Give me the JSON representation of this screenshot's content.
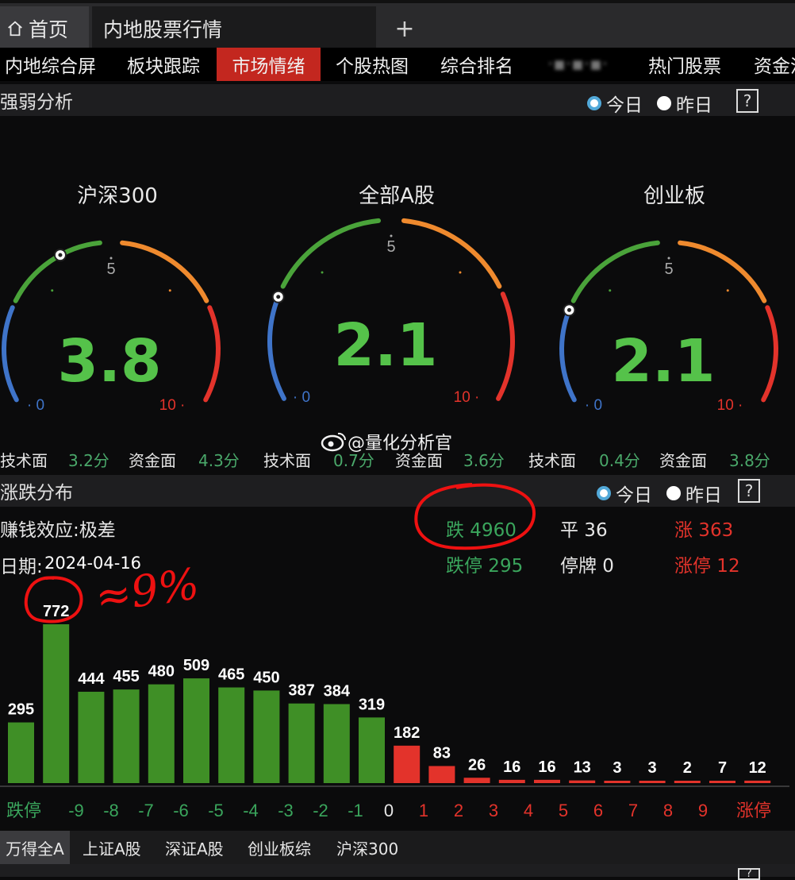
{
  "tabs": {
    "home": "首页",
    "active": "内地股票行情",
    "add": "+"
  },
  "nav": [
    "内地综合屏",
    "板块跟踪",
    "市场情绪",
    "个股热图",
    "综合排名",
    "·▪·▪·▪·",
    "热门股票",
    "资金流"
  ],
  "nav_active_index": 2,
  "strength": {
    "title": "强弱分析",
    "today": "今日",
    "yesterday": "昨日",
    "help": "?",
    "gauges": [
      {
        "title": "沪深300",
        "value": "3.8",
        "mid": "5",
        "min": "0",
        "max": "10",
        "level": 3.8,
        "tech_label": "技术面",
        "tech": "3.2分",
        "fund_label": "资金面",
        "fund": "4.3分"
      },
      {
        "title": "全部A股",
        "value": "2.1",
        "mid": "5",
        "min": "0",
        "max": "10",
        "level": 2.1,
        "tech_label": "技术面",
        "tech": "0.7分",
        "fund_label": "资金面",
        "fund": "3.6分"
      },
      {
        "title": "创业板",
        "value": "2.1",
        "mid": "5",
        "min": "0",
        "max": "10",
        "level": 2.1,
        "tech_label": "技术面",
        "tech": "0.4分",
        "fund_label": "资金面",
        "fund": "3.8分"
      }
    ]
  },
  "watermark": "@量化分析官",
  "distribution": {
    "title": "涨跌分布",
    "today": "今日",
    "yesterday": "昨日",
    "help": "?",
    "effect": "赚钱效应:极差",
    "date_label": "日期:",
    "date": "2024-04-16",
    "down": "跌 4960",
    "flat": "平 36",
    "up": "涨 363",
    "limit_down": "跌停 295",
    "suspended": "停牌 0",
    "limit_up": "涨停 12",
    "annotation": "≈9%"
  },
  "colors": {
    "green": "#3f8f26",
    "red": "#e3332b",
    "accent": "#c3271f"
  },
  "chart_data": {
    "type": "bar",
    "categories": [
      "跌停",
      "-9",
      "-8",
      "-7",
      "-6",
      "-5",
      "-4",
      "-3",
      "-2",
      "-1",
      "0",
      "1",
      "2",
      "3",
      "4",
      "5",
      "6",
      "7",
      "8",
      "9",
      "涨停"
    ],
    "values": [
      295,
      772,
      444,
      455,
      480,
      509,
      465,
      450,
      387,
      384,
      319,
      182,
      83,
      26,
      16,
      16,
      13,
      3,
      3,
      2,
      7,
      12
    ],
    "bar_colors": [
      "green",
      "green",
      "green",
      "green",
      "green",
      "green",
      "green",
      "green",
      "green",
      "green",
      "green",
      "red",
      "red",
      "red",
      "red",
      "red",
      "red",
      "red",
      "red",
      "red",
      "red",
      "red"
    ]
  },
  "bottom_tabs": [
    "万得全A",
    "上证A股",
    "深证A股",
    "创业板综",
    "沪深300"
  ],
  "bottom_active_index": 0,
  "next_panel_help": "?"
}
